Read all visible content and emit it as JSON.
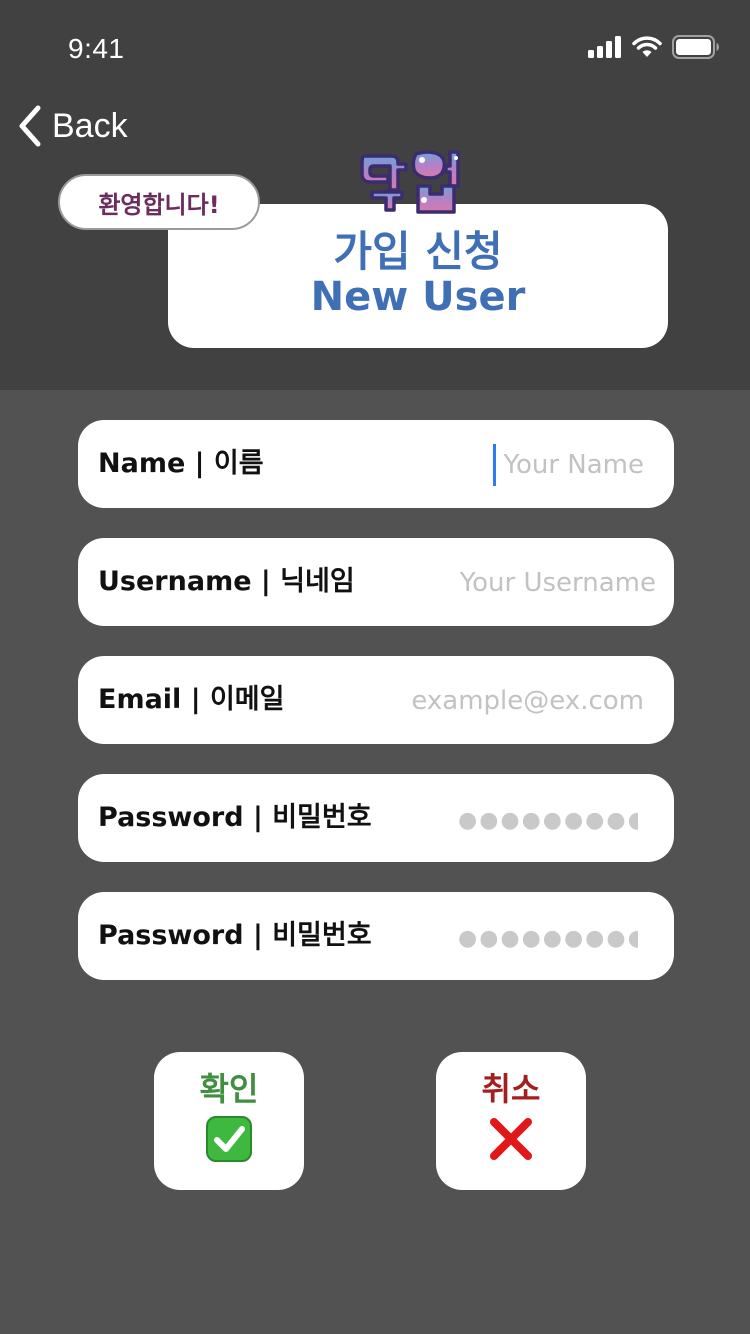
{
  "status_bar": {
    "time": "9:41"
  },
  "nav": {
    "back_label": "Back"
  },
  "header": {
    "welcome_badge": "환영합니다!",
    "logo_text": "덕업",
    "title_ko": "가입 신청",
    "title_en": "New User"
  },
  "form": {
    "fields": [
      {
        "label": "Name | 이름",
        "placeholder": "Your Name",
        "value": ""
      },
      {
        "label": "Username | 닉네임",
        "placeholder": "Your Username",
        "value": ""
      },
      {
        "label": "Email | 이메일",
        "placeholder": "example@ex.com",
        "value": ""
      },
      {
        "label": "Password | 비밀번호",
        "placeholder": "●●●●●●●●●",
        "value": ""
      },
      {
        "label": "Password | 비밀번호",
        "placeholder": "●●●●●●●●●",
        "value": ""
      }
    ]
  },
  "actions": {
    "confirm_label": "확인",
    "cancel_label": "취소"
  },
  "colors": {
    "header_bg": "#414141",
    "body_bg": "#525252",
    "title_blue": "#3f6fb5",
    "welcome_purple": "#6b2c5e",
    "confirm_green": "#3f8f3f",
    "cancel_red": "#a31f1f"
  },
  "icons": [
    "cellular-signal-icon",
    "wifi-icon",
    "battery-icon",
    "chevron-left-icon",
    "check-box-icon",
    "cross-icon"
  ]
}
